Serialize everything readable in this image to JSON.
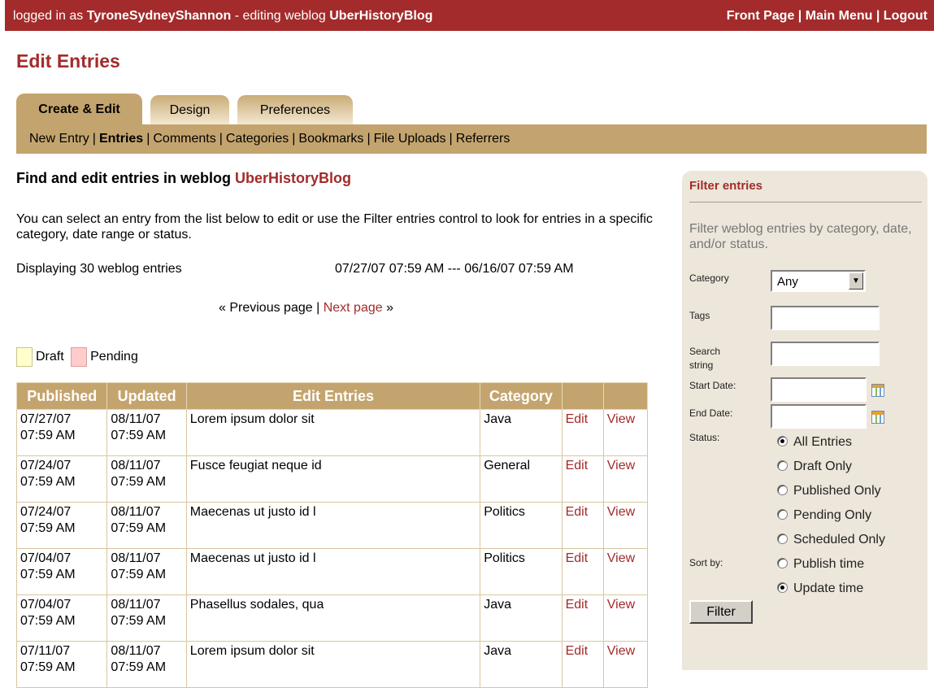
{
  "topbar": {
    "logged_in_prefix": "logged in as",
    "user": "TyroneSydneyShannon",
    "editing_prefix": "- editing weblog",
    "weblog": "UberHistoryBlog",
    "links": [
      "Front Page",
      "Main Menu",
      "Logout"
    ]
  },
  "page_title": "Edit Entries",
  "tabs": [
    "Create & Edit",
    "Design",
    "Preferences"
  ],
  "subnav": [
    "New Entry",
    "Entries",
    "Comments",
    "Categories",
    "Bookmarks",
    "File Uploads",
    "Referrers"
  ],
  "section": {
    "title_prefix": "Find and edit entries in weblog",
    "weblog": "UberHistoryBlog"
  },
  "intro": "You can select an entry from the list below to edit or use the Filter entries control to look for entries in a specific category, date range or status.",
  "displaying": "Displaying 30 weblog entries",
  "range": "07/27/07 07:59 AM --- 06/16/07 07:59 AM",
  "pager": {
    "prev": "« Previous page",
    "sep": "|",
    "next": "Next page",
    "next_arrow": "»"
  },
  "legend": {
    "draft": "Draft",
    "pending": "Pending",
    "draft_color": "#ffffcc",
    "pending_color": "#ffcccc"
  },
  "table": {
    "headers": [
      "Published",
      "Updated",
      "Edit Entries",
      "Category",
      "",
      ""
    ],
    "rows": [
      {
        "published": [
          "07/27/07",
          "07:59 AM"
        ],
        "updated": [
          "08/11/07",
          "07:59 AM"
        ],
        "title": "Lorem ipsum dolor sit",
        "category": "Java",
        "edit": "Edit",
        "view": "View"
      },
      {
        "published": [
          "07/24/07",
          "07:59 AM"
        ],
        "updated": [
          "08/11/07",
          "07:59 AM"
        ],
        "title": "Fusce feugiat neque id",
        "category": "General",
        "edit": "Edit",
        "view": "View"
      },
      {
        "published": [
          "07/24/07",
          "07:59 AM"
        ],
        "updated": [
          "08/11/07",
          "07:59 AM"
        ],
        "title": "Maecenas ut justo id l",
        "category": "Politics",
        "edit": "Edit",
        "view": "View"
      },
      {
        "published": [
          "07/04/07",
          "07:59 AM"
        ],
        "updated": [
          "08/11/07",
          "07:59 AM"
        ],
        "title": "Maecenas ut justo id l",
        "category": "Politics",
        "edit": "Edit",
        "view": "View"
      },
      {
        "published": [
          "07/04/07",
          "07:59 AM"
        ],
        "updated": [
          "08/11/07",
          "07:59 AM"
        ],
        "title": "Phasellus sodales, qua",
        "category": "Java",
        "edit": "Edit",
        "view": "View"
      },
      {
        "published": [
          "07/11/07",
          "07:59 AM"
        ],
        "updated": [
          "08/11/07",
          "07:59 AM"
        ],
        "title": "Lorem ipsum dolor sit",
        "category": "Java",
        "edit": "Edit",
        "view": "View"
      }
    ]
  },
  "filter": {
    "title": "Filter entries",
    "description": "Filter weblog entries by category, date, and/or status.",
    "category_label": "Category",
    "category_value": "Any",
    "tags_label": "Tags",
    "search_label_1": "Search",
    "search_label_2": "string",
    "start_label": "Start Date:",
    "end_label": "End Date:",
    "status_label": "Status:",
    "status_options": [
      "All Entries",
      "Draft Only",
      "Published Only",
      "Pending Only",
      "Scheduled Only"
    ],
    "status_selected": "All Entries",
    "sort_label": "Sort by:",
    "sort_options": [
      "Publish time",
      "Update time"
    ],
    "sort_selected": "Update time",
    "button": "Filter"
  },
  "colors": {
    "brand": "#a32b2b",
    "tan": "#c4a46e",
    "panel": "#ede6da"
  }
}
